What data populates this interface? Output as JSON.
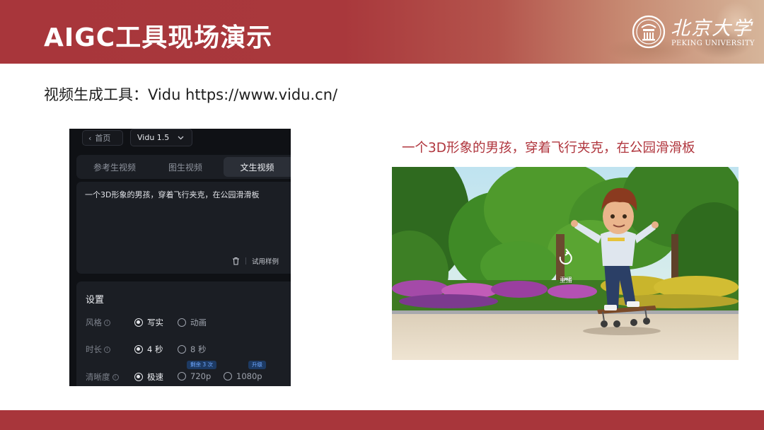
{
  "slide": {
    "title": "AIGC工具现场演示",
    "subtitle": "视频生成工具：Vidu  https://www.vidu.cn/",
    "logo": {
      "name_cn": "北京大学",
      "name_en": "PEKING UNIVERSITY"
    },
    "colors": {
      "brand_red": "#a8363b",
      "caption_red": "#b0363e"
    }
  },
  "vidu": {
    "back_label": "首页",
    "model_label": "Vidu 1.5",
    "tabs": [
      {
        "label": "参考生视频",
        "active": false
      },
      {
        "label": "图生视频",
        "active": false
      },
      {
        "label": "文生视频",
        "active": true
      }
    ],
    "prompt_text": "一个3D形象的男孩，穿着飞行夹克，在公园滑滑板",
    "try_sample_label": "试用样例",
    "settings": {
      "title": "设置",
      "style": {
        "label": "风格",
        "options": [
          "写实",
          "动画"
        ],
        "selected": "写实"
      },
      "duration": {
        "label": "时长",
        "options": [
          "4 秒",
          "8 秒"
        ],
        "selected": "4 秒"
      },
      "quality": {
        "label": "清晰度",
        "options": [
          "极速",
          "720p",
          "1080p"
        ],
        "selected": "极速",
        "badges": {
          "remaining": "剩余 3 次",
          "upgrade": "升级"
        }
      }
    }
  },
  "preview": {
    "caption": "一个3D形象的男孩，穿着飞行夹克，在公园滑滑板",
    "replay_label": "重播"
  }
}
